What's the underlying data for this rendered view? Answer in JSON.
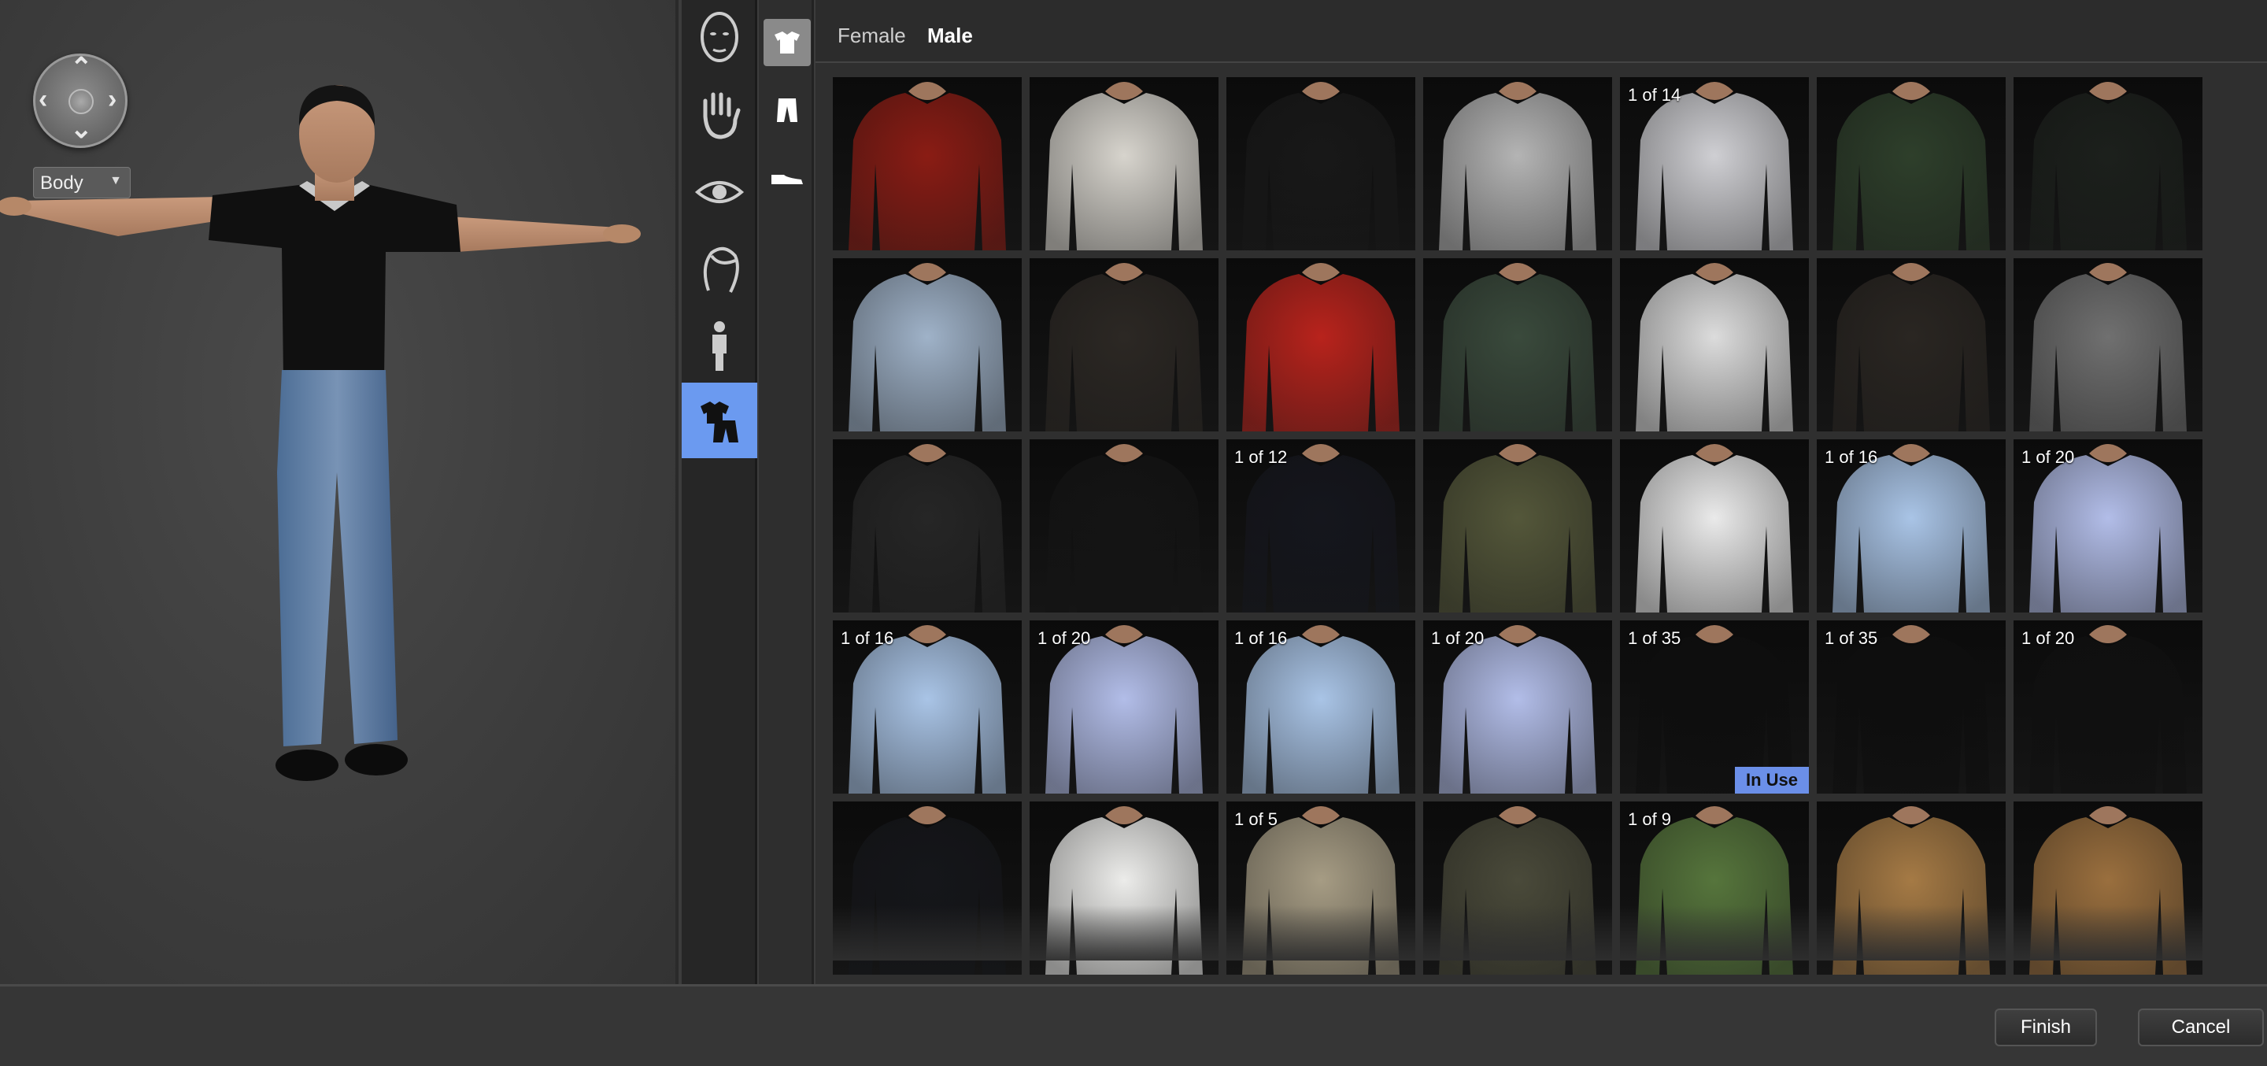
{
  "preview": {
    "body_select": "Body"
  },
  "gender_tabs": [
    {
      "label": "Female",
      "active": false
    },
    {
      "label": "Male",
      "active": true
    }
  ],
  "categories": [
    "face-icon",
    "hand-icon",
    "eye-icon",
    "hair-icon",
    "body-icon",
    "clothing-icon"
  ],
  "subcategories": [
    "shirt-icon",
    "pants-icon",
    "shoes-icon"
  ],
  "grid": {
    "columns": 7,
    "tiles": [
      {
        "color": "#8a1c14",
        "count": "",
        "in_use": false
      },
      {
        "color": "#d7d4cd",
        "count": "",
        "in_use": false
      },
      {
        "color": "#181818",
        "count": "",
        "in_use": false
      },
      {
        "color": "#b4b4b4",
        "count": "",
        "in_use": false
      },
      {
        "color": "#cfcfd3",
        "count": "1 of 14",
        "in_use": false
      },
      {
        "color": "#2e3f2b",
        "count": "",
        "in_use": false
      },
      {
        "color": "#1c201c",
        "count": "",
        "in_use": false
      },
      {
        "color": "#9fb2c8",
        "count": "",
        "in_use": false
      },
      {
        "color": "#2c2824",
        "count": "",
        "in_use": false
      },
      {
        "color": "#b8231c",
        "count": "",
        "in_use": false
      },
      {
        "color": "#3a4a3c",
        "count": "",
        "in_use": false
      },
      {
        "color": "#dcdcdc",
        "count": "",
        "in_use": false
      },
      {
        "color": "#2a2622",
        "count": "",
        "in_use": false
      },
      {
        "color": "#707070",
        "count": "",
        "in_use": false
      },
      {
        "color": "#262626",
        "count": "",
        "in_use": false
      },
      {
        "color": "#141414",
        "count": "",
        "in_use": false
      },
      {
        "color": "#15161d",
        "count": "1 of 12",
        "in_use": false
      },
      {
        "color": "#54573a",
        "count": "",
        "in_use": false
      },
      {
        "color": "#eaeaea",
        "count": "",
        "in_use": false
      },
      {
        "color": "#a9c4e6",
        "count": "1 of 16",
        "in_use": false
      },
      {
        "color": "#b2bde8",
        "count": "1 of 20",
        "in_use": false
      },
      {
        "color": "#a9c4e6",
        "count": "1 of 16",
        "in_use": false
      },
      {
        "color": "#b2bde8",
        "count": "1 of 20",
        "in_use": false
      },
      {
        "color": "#a9c4e6",
        "count": "1 of 16",
        "in_use": false
      },
      {
        "color": "#b2bde8",
        "count": "1 of 20",
        "in_use": false
      },
      {
        "color": "#0e0e0e",
        "count": "1 of 35",
        "in_use": true
      },
      {
        "color": "#0e0e0e",
        "count": "1 of 35",
        "in_use": false
      },
      {
        "color": "#101010",
        "count": "1 of 20",
        "in_use": false
      },
      {
        "color": "#15161a",
        "count": "",
        "in_use": false
      },
      {
        "color": "#ececea",
        "count": "",
        "in_use": false
      },
      {
        "color": "#a69c84",
        "count": "1 of 5",
        "in_use": false
      },
      {
        "color": "#4a4a3a",
        "count": "",
        "in_use": false
      },
      {
        "color": "#56753c",
        "count": "1 of 9",
        "in_use": false
      },
      {
        "color": "#a57a45",
        "count": "",
        "in_use": false
      },
      {
        "color": "#9a6f3e",
        "count": "",
        "in_use": false
      }
    ]
  },
  "in_use_label": "In Use",
  "footer": {
    "finish": "Finish",
    "cancel": "Cancel"
  }
}
